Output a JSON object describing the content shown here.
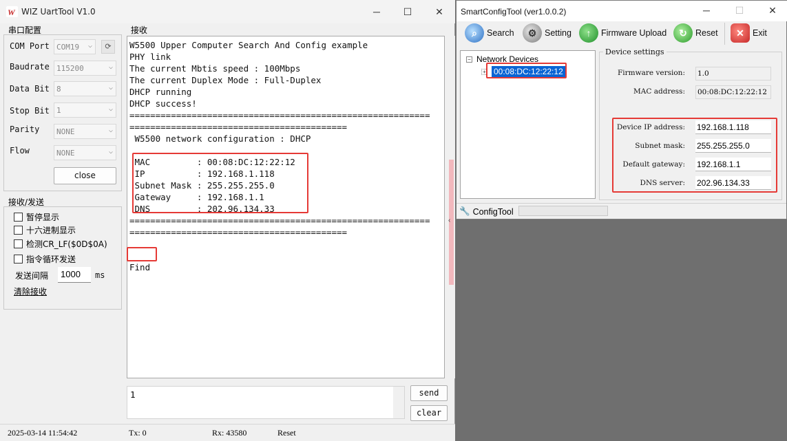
{
  "uart": {
    "title": "WIZ UartTool V1.0",
    "serial_group": "串口配置",
    "fields": [
      {
        "label": "COM Port",
        "value": "COM19"
      },
      {
        "label": "Baudrate",
        "value": "115200"
      },
      {
        "label": "Data Bit",
        "value": "8"
      },
      {
        "label": "Stop Bit",
        "value": "1"
      },
      {
        "label": "Parity",
        "value": "NONE"
      },
      {
        "label": "Flow",
        "value": "NONE"
      }
    ],
    "close_label": "close",
    "sendrecv_group": "接收/发送",
    "checks": [
      "暂停显示",
      "十六进制显示",
      "检测CR_LF($0D$0A)",
      "指令循环发送"
    ],
    "interval_label": "发送间隔",
    "interval_value": "1000",
    "interval_unit": "ms",
    "clear_recv": "清除接收",
    "recv_group": "接收",
    "recv_lines": [
      "W5500 Upper Computer Search And Config example",
      "PHY link",
      "The current Mbtis speed : 100Mbps",
      "The current Duplex Mode : Full-Duplex",
      "DHCP running",
      "DHCP success!",
      "==========================================================",
      "==========================================",
      " W5500 network configuration : DHCP",
      "",
      " MAC         : 00:08:DC:12:22:12",
      " IP          : 192.168.1.118",
      " Subnet Mask : 255.255.255.0",
      " Gateway     : 192.168.1.1",
      " DNS         : 202.96.134.33",
      "==========================================================",
      "==========================================",
      "",
      "",
      "Find"
    ],
    "send_text": "1",
    "send_label": "send",
    "clear_label": "clear",
    "status": {
      "datetime": "2025-03-14 11:54:42",
      "tx": "Tx: 0",
      "rx": "Rx: 43580",
      "reset": "Reset"
    }
  },
  "sct": {
    "title": "SmartConfigTool (ver1.0.0.2)",
    "toolbar": {
      "search": "Search",
      "setting": "Setting",
      "firmware": "Firmware Upload",
      "reset": "Reset",
      "exit": "Exit"
    },
    "tree_root": "Network Devices",
    "device": "00:08:DC:12:22:12",
    "settings_title": "Device settings",
    "firmware_label": "Firmware version:",
    "firmware_value": "1.0",
    "mac_label": "MAC address:",
    "mac_value": "00:08:DC:12:22:12",
    "ip_label": "Device IP address:",
    "ip_value": "192.168.1.118",
    "mask_label": "Subnet mask:",
    "mask_value": "255.255.255.0",
    "gw_label": "Default gateway:",
    "gw_value": "192.168.1.1",
    "dns_label": "DNS server:",
    "dns_value": "202.96.134.33",
    "status_label": "ConfigTool"
  },
  "colors": {
    "highlight": "#e53935",
    "selection": "#0a64d4",
    "scroll_thumb": "#f2b8bd"
  }
}
